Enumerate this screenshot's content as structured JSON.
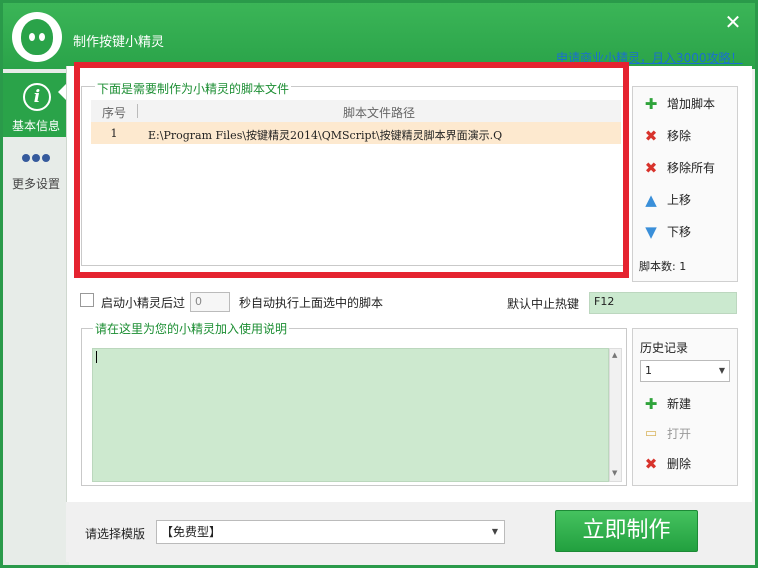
{
  "window": {
    "title": "制作按键小精灵",
    "close_glyph": "✕",
    "promo_link": "申请商业小精灵，月入3000攻略！"
  },
  "sidebar": {
    "items": [
      {
        "label": "基本信息",
        "icon": "info-icon",
        "active": true
      },
      {
        "label": "更多设置",
        "icon": "more-dots-icon",
        "active": false
      }
    ]
  },
  "scripts": {
    "group_title": "下面是需要制作为小精灵的脚本文件",
    "columns": {
      "num": "序号",
      "path": "脚本文件路径"
    },
    "rows": [
      {
        "num": "1",
        "path": "E:\\Program Files\\按键精灵2014\\QMScript\\按键精灵脚本界面演示.Q"
      }
    ],
    "buttons": {
      "add": "增加脚本",
      "remove": "移除",
      "remove_all": "移除所有",
      "move_up": "上移",
      "move_down": "下移"
    },
    "count_label": "脚本数:  1"
  },
  "options": {
    "auto_run_label": "启动小精灵后过",
    "auto_run_seconds": "0",
    "auto_run_suffix": "秒自动执行上面选中的脚本",
    "hotkey_label": "默认中止热键",
    "hotkey_value": "F12"
  },
  "description": {
    "group_title": "请在这里为您的小精灵加入使用说明",
    "text": ""
  },
  "history": {
    "title": "历史记录",
    "selected": "1",
    "buttons": {
      "new": "新建",
      "open": "打开",
      "delete": "删除"
    }
  },
  "footer": {
    "template_label": "请选择模版",
    "template_value": "【免费型】",
    "make_button": "立即制作"
  },
  "colors": {
    "accent": "#2aa349",
    "highlight_box": "#e52330",
    "selected_row": "#fde9cf",
    "text_area": "#cde9cf"
  }
}
